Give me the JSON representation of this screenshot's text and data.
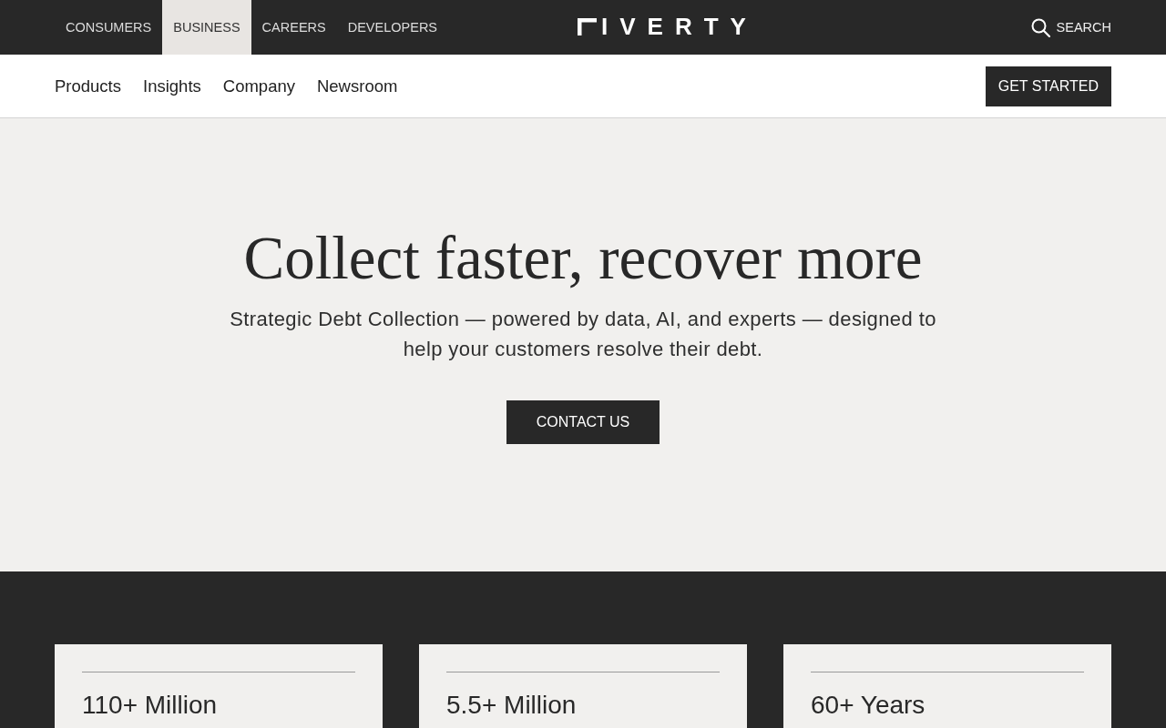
{
  "top_bar": {
    "audience_tabs": [
      {
        "label": "CONSUMERS",
        "selected": false
      },
      {
        "label": "BUSINESS",
        "selected": true
      },
      {
        "label": "CAREERS",
        "selected": false
      },
      {
        "label": "DEVELOPERS",
        "selected": false
      }
    ],
    "logo": {
      "text": "IVERTY"
    },
    "search": {
      "label": "SEARCH"
    }
  },
  "main_nav": {
    "links": [
      "Products",
      "Insights",
      "Company",
      "Newsroom"
    ],
    "cta": "GET STARTED"
  },
  "hero": {
    "title": "Collect faster, recover more",
    "subtitle": "Strategic Debt Collection — powered by data, AI, and experts — designed to help your customers resolve their debt.",
    "button": "CONTACT US"
  },
  "stats": [
    {
      "value": "110+ Million"
    },
    {
      "value": "5.5+ Million"
    },
    {
      "value": "60+ Years"
    }
  ]
}
